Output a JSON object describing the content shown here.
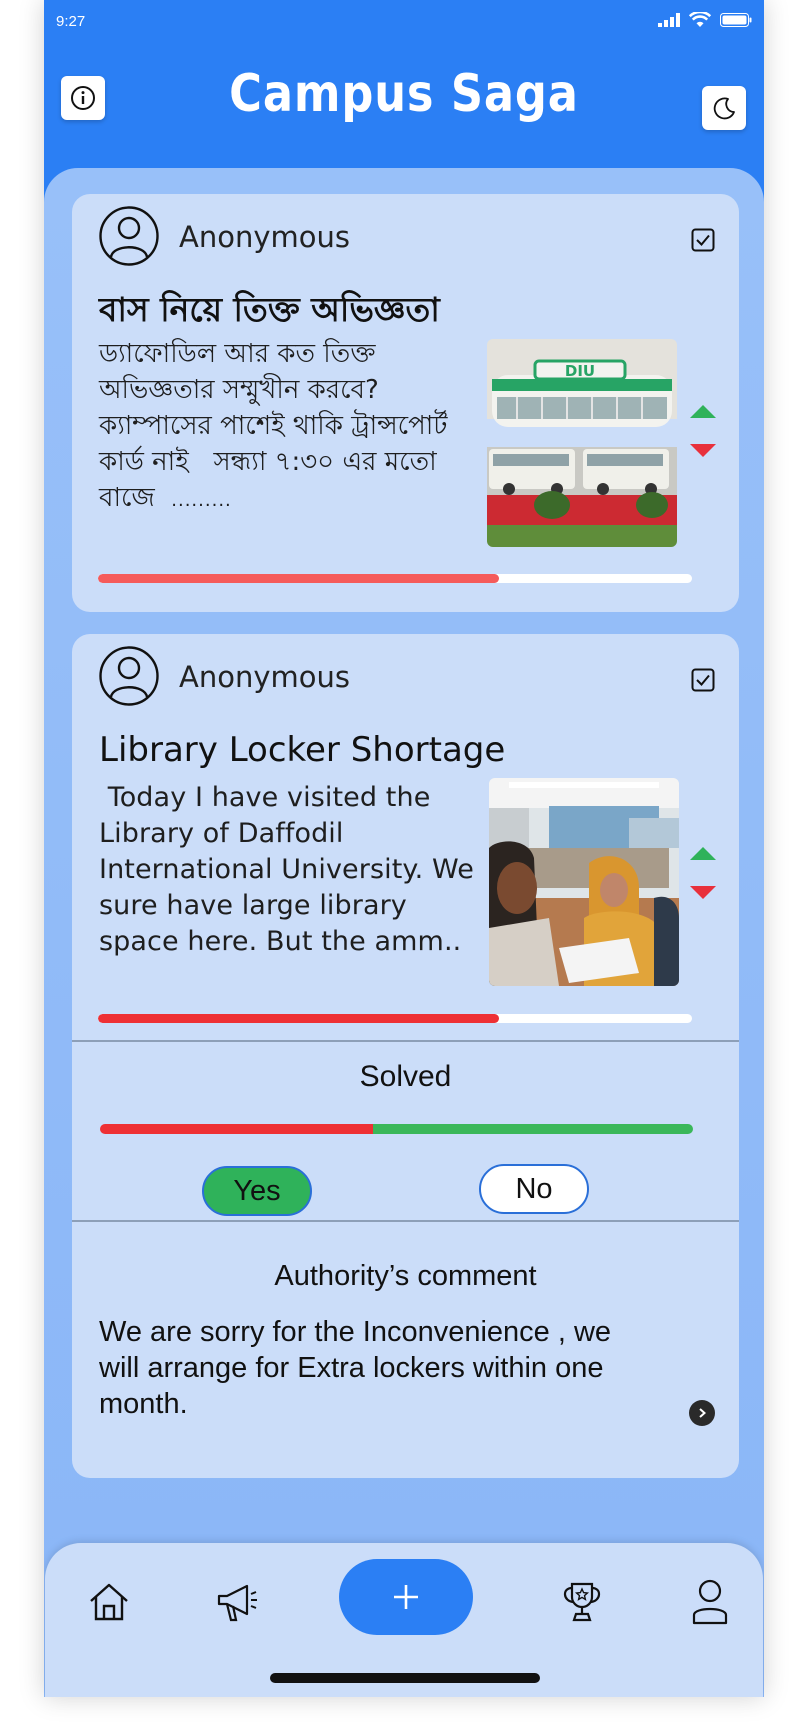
{
  "status_bar": {
    "time": "9:27"
  },
  "header": {
    "title": "Campus Saga"
  },
  "posts": [
    {
      "author": "Anonymous",
      "title": "বাস নিয়ে তিক্ত অভিজ্ঞতা",
      "body": "ড্যাফোডিল আর কত তিক্ত অভিজ্ঞতার সম্মুখীন করবে? ক্যাম্পাসের পাশেই থাকি ট্রান্সপোর্ট কার্ড নাই   সন্ধ্যা ৭:৩০ এর মতো বাজে",
      "ellipsis": ".........",
      "image_label": "DIU",
      "progress": 0.675
    },
    {
      "author": "Anonymous",
      "title": "Library Locker Shortage",
      "body": " Today I have visited the Library of Daffodil International University. We sure have large library space here. But the amm..",
      "progress": 0.675,
      "solved": {
        "title": "Solved",
        "yes_share": 0.46,
        "yes_label": "Yes",
        "no_label": "No"
      },
      "authority": {
        "title": "Authority’s comment",
        "comment": "We are sorry  for the  Inconvenience , we will arrange for Extra lockers within one month."
      }
    }
  ],
  "colors": {
    "primary": "#2B7FF4",
    "card": "#CBDDF9",
    "up_vote": "#2FB25A",
    "down_vote": "#E8303C"
  },
  "nav": {
    "items": [
      "home-icon",
      "megaphone-icon",
      "add-icon",
      "trophy-icon",
      "profile-icon"
    ]
  }
}
